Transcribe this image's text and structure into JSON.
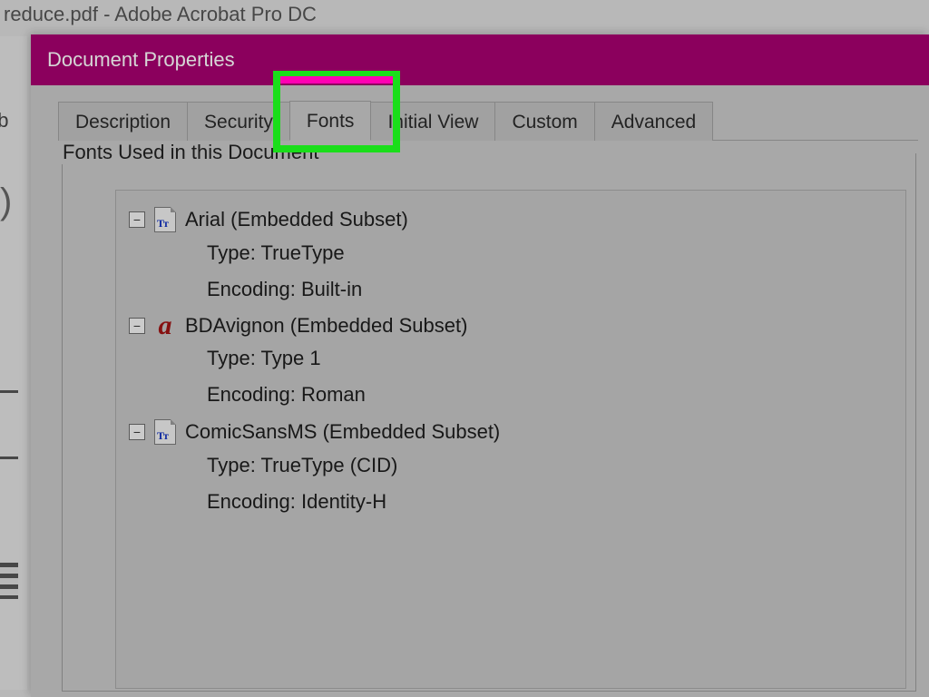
{
  "background_app": {
    "title": "reduce.pdf - Adobe Acrobat Pro DC",
    "sidebar_fragment": "rib"
  },
  "dialog": {
    "title": "Document Properties",
    "tabs": [
      {
        "id": "description",
        "label": "Description"
      },
      {
        "id": "security",
        "label": "Security"
      },
      {
        "id": "fonts",
        "label": "Fonts"
      },
      {
        "id": "initialview",
        "label": "Initial View"
      },
      {
        "id": "custom",
        "label": "Custom"
      },
      {
        "id": "advanced",
        "label": "Advanced"
      }
    ],
    "active_tab": "fonts",
    "group_label": "Fonts Used in this Document",
    "labels": {
      "type": "Type:",
      "encoding": "Encoding:"
    },
    "fonts": [
      {
        "name": "Arial (Embedded Subset)",
        "icon": "tt",
        "type": "TrueType",
        "encoding": "Built-in"
      },
      {
        "name": "BDAvignon (Embedded Subset)",
        "icon": "a",
        "type": "Type 1",
        "encoding": "Roman"
      },
      {
        "name": "ComicSansMS (Embedded Subset)",
        "icon": "tt",
        "type": "TrueType (CID)",
        "encoding": "Identity-H"
      }
    ]
  },
  "highlight": {
    "target_tab": "fonts",
    "color": "#1ade1a"
  }
}
